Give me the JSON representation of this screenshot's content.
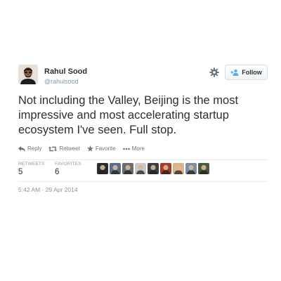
{
  "user": {
    "name": "Rahul Sood",
    "handle": "@rahulsood"
  },
  "header": {
    "follow_label": "Follow",
    "gear_icon": "gear-icon",
    "follow_icon": "add-user-icon"
  },
  "tweet": {
    "text_line1": "Not including the Valley, Beijing is the most",
    "text_line2": "impressive and most accelerating startup",
    "text_line3": "ecosystem I've seen.  Full stop."
  },
  "actions": {
    "reply_label": "Reply",
    "retweet_label": "Retweet",
    "favorite_label": "Favorite",
    "more_label": "More"
  },
  "stats": {
    "retweets_label": "RETWEETS",
    "retweets_value": "5",
    "favorites_label": "FAVORITES",
    "favorites_value": "6"
  },
  "favoriters": {
    "count_shown": 9,
    "colors": [
      "#2b2b2b",
      "#5a6e8c",
      "#6b6b6b",
      "#c9c9c9",
      "#3d3d3d",
      "#a33b2e",
      "#d9b48a",
      "#7a8fa6",
      "#4a5a3a"
    ]
  },
  "timestamp": "5:42 AM - 29 Apr 2014",
  "colors": {
    "text": "#292f33",
    "muted": "#8899a6",
    "action": "#66757f",
    "border": "#e6ecf0"
  }
}
